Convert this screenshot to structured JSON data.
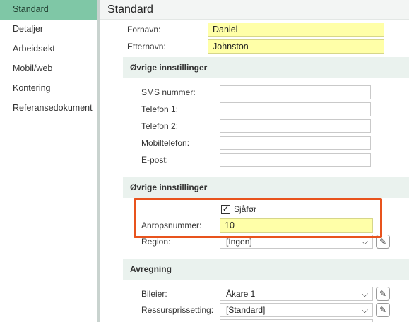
{
  "sidebar": {
    "items": [
      {
        "label": "Standard"
      },
      {
        "label": "Detaljer"
      },
      {
        "label": "Arbeidsøkt"
      },
      {
        "label": "Mobil/web"
      },
      {
        "label": "Kontering"
      },
      {
        "label": "Referansedokument"
      }
    ]
  },
  "page": {
    "title": "Standard"
  },
  "name": {
    "first_label": "Fornavn:",
    "first_value": "Daniel",
    "last_label": "Etternavn:",
    "last_value": "Johnston"
  },
  "other1": {
    "header": "Øvrige innstillinger",
    "sms_label": "SMS nummer:",
    "sms_value": "",
    "phone1_label": "Telefon 1:",
    "phone1_value": "",
    "phone2_label": "Telefon 2:",
    "phone2_value": "",
    "mobile_label": "Mobiltelefon:",
    "mobile_value": "",
    "email_label": "E-post:",
    "email_value": ""
  },
  "other2": {
    "header": "Øvrige innstillinger",
    "driver_label": "Sjåfør",
    "driver_checked": true,
    "call_label": "Anropsnummer:",
    "call_value": "10",
    "region_label": "Region:",
    "region_value": "[Ingen]"
  },
  "billing": {
    "header": "Avregning",
    "owner_label": "Bileier:",
    "owner_value": "Åkare 1",
    "cost_label": "Ressursprissetting:",
    "cost_value": "[Standard]"
  },
  "colors": {
    "active": "#7fc7a6",
    "highlight": "#e8531d",
    "input_yellow": "#ffffa8",
    "section_bg": "#eaf2ee"
  },
  "icons": {
    "dropdown": "chevron-down-icon",
    "edit": "pencil-icon",
    "check": "checkmark-icon"
  }
}
